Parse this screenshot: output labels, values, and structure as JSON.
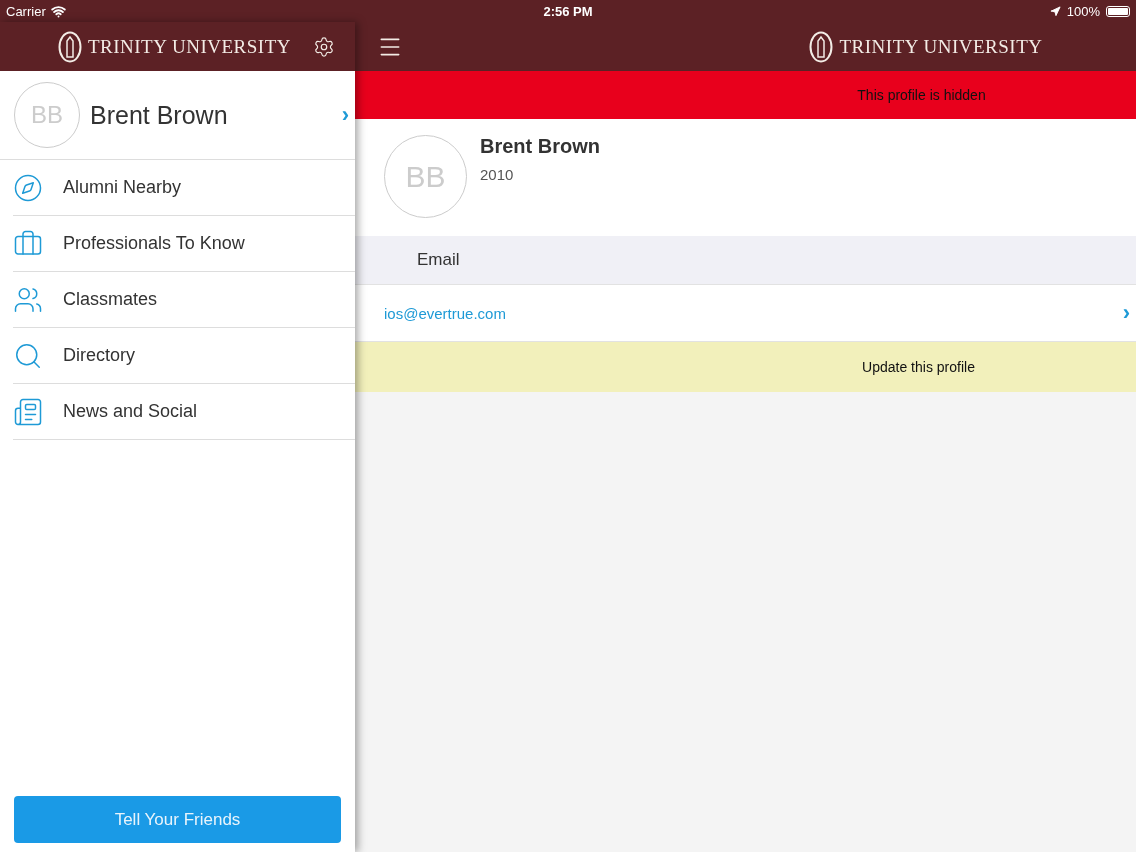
{
  "status_bar": {
    "carrier": "Carrier",
    "time": "2:56 PM",
    "battery": "100%"
  },
  "sidebar": {
    "logo_text": "TRINITY UNIVERSITY",
    "profile": {
      "initials": "BB",
      "name": "Brent Brown",
      "chevron": "›"
    },
    "items": [
      {
        "label": "Alumni Nearby",
        "kind": "compass"
      },
      {
        "label": "Professionals To Know",
        "kind": "briefcase"
      },
      {
        "label": "Classmates",
        "kind": "people"
      },
      {
        "label": "Directory",
        "kind": "search"
      },
      {
        "label": "News and Social",
        "kind": "news"
      }
    ],
    "button": "Tell Your Friends"
  },
  "main": {
    "logo_text": "TRINITY UNIVERSITY",
    "banner": "This profile is hidden",
    "profile": {
      "initials": "BB",
      "name": "Brent Brown",
      "year": "2010"
    },
    "section_header": "Email",
    "email": "ios@evertrue.com",
    "email_chevron": "›",
    "update_button": "Update this profile"
  }
}
